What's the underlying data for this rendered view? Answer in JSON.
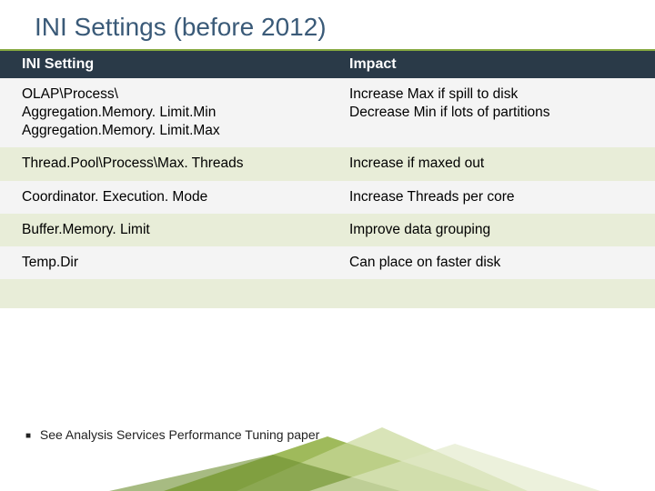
{
  "title": "INI Settings (before 2012)",
  "table": {
    "headers": [
      "INI Setting",
      "Impact"
    ],
    "rows": [
      {
        "setting": "OLAP\\Process\\\nAggregation.Memory. Limit.Min\nAggregation.Memory. Limit.Max",
        "impact": "Increase Max if spill to disk\nDecrease Min if lots of partitions"
      },
      {
        "setting": "Thread.Pool\\Process\\Max. Threads",
        "impact": "Increase if maxed out"
      },
      {
        "setting": "Coordinator. Execution. Mode",
        "impact": "Increase Threads per core"
      },
      {
        "setting": "Buffer.Memory. Limit",
        "impact": "Improve data grouping"
      },
      {
        "setting": "Temp.Dir",
        "impact": "Can place on faster disk"
      },
      {
        "setting": "",
        "impact": ""
      }
    ]
  },
  "footnote": "See Analysis Services Performance Tuning paper"
}
